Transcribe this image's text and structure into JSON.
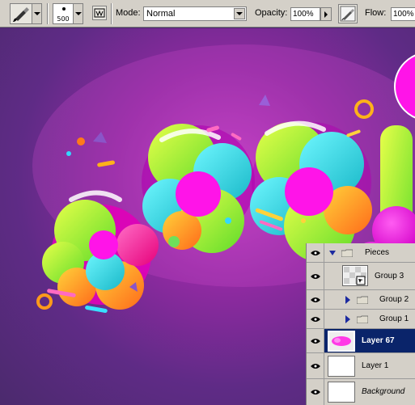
{
  "options_bar": {
    "brush_size": "500",
    "mode_label": "Mode:",
    "mode_value": "Normal",
    "opacity_label": "Opacity:",
    "opacity_value": "100%",
    "flow_label": "Flow:",
    "flow_value": "100%",
    "icons": [
      "brush-tool-icon",
      "brush-preset-icon",
      "airbrush-icon",
      "brush-panel-icon"
    ]
  },
  "layers": {
    "items": [
      {
        "name": "Pieces",
        "type": "group",
        "expanded": true,
        "visible": true
      },
      {
        "name": "Group 3",
        "type": "group-thumbnail",
        "visible": true
      },
      {
        "name": "Group 2",
        "type": "group",
        "expanded": false,
        "visible": true
      },
      {
        "name": "Group 1",
        "type": "group",
        "expanded": false,
        "visible": true
      },
      {
        "name": "Layer 67",
        "type": "layer",
        "visible": true,
        "selected": true
      },
      {
        "name": "Layer 1",
        "type": "layer",
        "visible": true
      },
      {
        "name": "Background",
        "type": "background",
        "visible": true
      }
    ]
  },
  "colors": {
    "panel_bg": "#d4d0c8",
    "selection": "#0a246a",
    "canvas_purple": "#5f2b86",
    "magenta": "#ff00e6",
    "lime": "#b8ff2a",
    "cyan": "#26e0d2",
    "orange": "#ff9a1a"
  }
}
